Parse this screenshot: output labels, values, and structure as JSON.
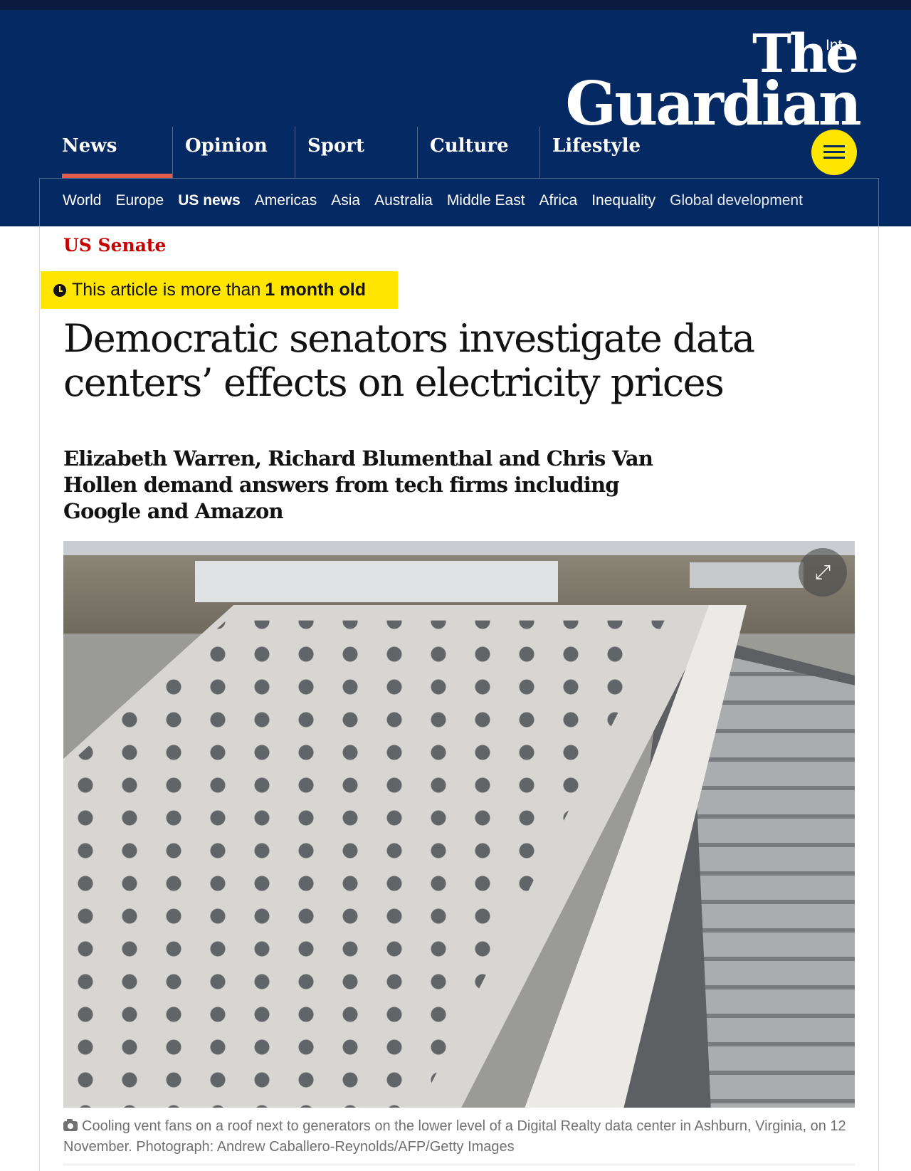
{
  "header": {
    "edition_label": "Int",
    "logo_line1": "The",
    "logo_line2": "Guardian",
    "pillars": [
      {
        "label": "News"
      },
      {
        "label": "Opinion"
      },
      {
        "label": "Sport"
      },
      {
        "label": "Culture"
      },
      {
        "label": "Lifestyle"
      }
    ],
    "subnav": [
      {
        "label": "World"
      },
      {
        "label": "Europe"
      },
      {
        "label": "US news"
      },
      {
        "label": "Americas"
      },
      {
        "label": "Asia"
      },
      {
        "label": "Australia"
      },
      {
        "label": "Middle East"
      },
      {
        "label": "Africa"
      },
      {
        "label": "Inequality"
      },
      {
        "label": "Global development"
      }
    ]
  },
  "article": {
    "kicker": "US Senate",
    "age_notice_prefix": "This article is more than",
    "age_notice_bold": "1 month old",
    "headline": "Democratic senators investigate data centers’ effects on electricity prices",
    "standfirst": "Elizabeth Warren, Richard Blumenthal and Chris Van Hollen demand answers from tech firms including Google and Amazon",
    "caption": "Cooling vent fans on a roof next to generators on the lower level of a Digital Realty data center in Ashburn, Virginia, on 12 November. Photograph: Andrew Caballero-Reynolds/AFP/Getty Images"
  },
  "colors": {
    "brand_blue": "#052962",
    "kicker_red": "#c70000",
    "badge_yellow": "#ffe500",
    "news_underline": "#e05e4a"
  }
}
